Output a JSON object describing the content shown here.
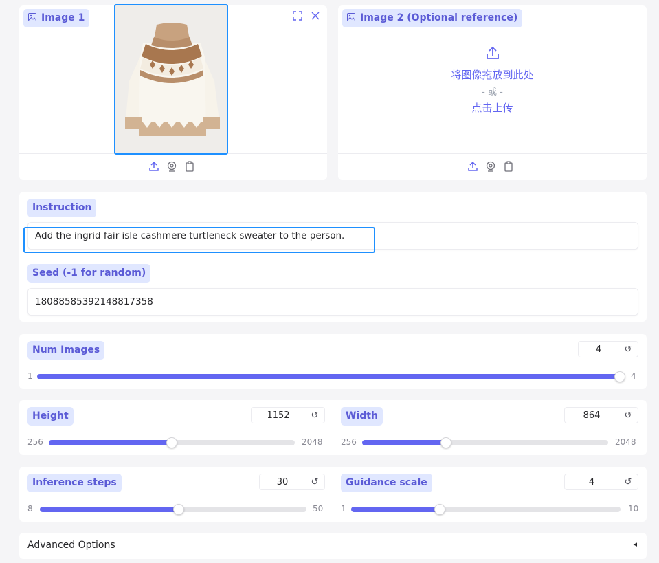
{
  "image1": {
    "label": "Image 1"
  },
  "image2": {
    "label": "Image 2 (Optional reference)",
    "drop_text": "将图像拖放到此处",
    "or_text": "- 或 -",
    "click_text": "点击上传"
  },
  "instruction": {
    "label": "Instruction",
    "value": "Add the ingrid fair isle cashmere turtleneck sweater to the person."
  },
  "seed": {
    "label": "Seed (-1 for random)",
    "value": "18088585392148817358"
  },
  "num_images": {
    "label": "Num Images",
    "value": "4",
    "min": "1",
    "max": "4",
    "fraction": 1.0
  },
  "height": {
    "label": "Height",
    "value": "1152",
    "min": "256",
    "max": "2048",
    "fraction": 0.5
  },
  "width": {
    "label": "Width",
    "value": "864",
    "min": "256",
    "max": "2048",
    "fraction": 0.34
  },
  "inference_steps": {
    "label": "Inference steps",
    "value": "30",
    "min": "8",
    "max": "50",
    "fraction": 0.52
  },
  "guidance_scale": {
    "label": "Guidance scale",
    "value": "4",
    "min": "1",
    "max": "10",
    "fraction": 0.33
  },
  "advanced": {
    "label": "Advanced Options",
    "arrow": "◂"
  },
  "reset_glyph": "↺",
  "colors": {
    "accent": "#6366f1",
    "badge_bg": "#e0e7ff",
    "badge_text": "#5b5bd6",
    "highlight": "#1e90ff"
  }
}
